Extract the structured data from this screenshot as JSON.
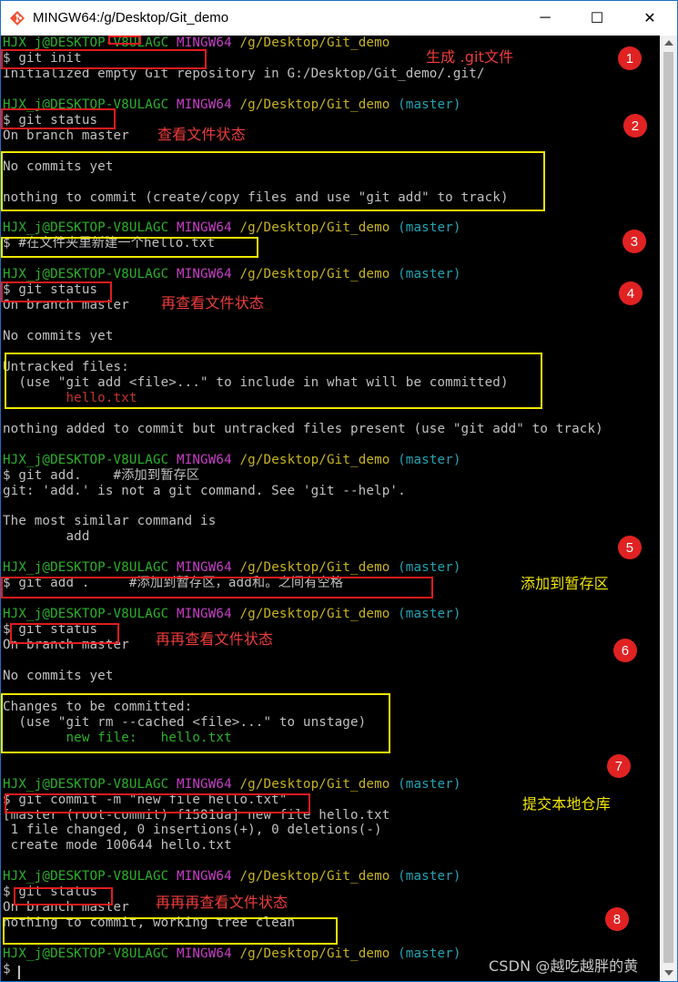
{
  "window": {
    "title": "MINGW64:/g/Desktop/Git_demo",
    "minimize_glyph": "─",
    "maximize_glyph": "☐",
    "close_glyph": "✕"
  },
  "prompt": {
    "user": "HJX_j@DESKTOP-V8ULAGC",
    "shell": "MINGW64",
    "path": "/g/Desktop/Git_demo",
    "branch": "(master)"
  },
  "lines": [
    {
      "segments": [
        {
          "t": "HJX_j@DESKTOP-V8ULAGC",
          "c": "g"
        },
        {
          "t": " "
        },
        {
          "t": "MINGW64",
          "c": "m"
        },
        {
          "t": " "
        },
        {
          "t": "/g/Desktop/Git_demo",
          "c": "y"
        }
      ]
    },
    {
      "segments": [
        {
          "t": "$ git init"
        }
      ]
    },
    {
      "segments": [
        {
          "t": "Initialized empty Git repository in G:/Desktop/Git_demo/.git/"
        }
      ]
    },
    {
      "segments": []
    },
    {
      "segments": [
        {
          "t": "HJX_j@DESKTOP-V8ULAGC",
          "c": "g"
        },
        {
          "t": " "
        },
        {
          "t": "MINGW64",
          "c": "m"
        },
        {
          "t": " "
        },
        {
          "t": "/g/Desktop/Git_demo",
          "c": "y"
        },
        {
          "t": " "
        },
        {
          "t": "(master)",
          "c": "c"
        }
      ]
    },
    {
      "segments": [
        {
          "t": "$ git status"
        }
      ]
    },
    {
      "segments": [
        {
          "t": "On branch master"
        }
      ]
    },
    {
      "segments": []
    },
    {
      "segments": [
        {
          "t": "No commits yet"
        }
      ]
    },
    {
      "segments": []
    },
    {
      "segments": [
        {
          "t": "nothing to commit (create/copy files and use \"git add\" to track)"
        }
      ]
    },
    {
      "segments": []
    },
    {
      "segments": [
        {
          "t": "HJX_j@DESKTOP-V8ULAGC",
          "c": "g"
        },
        {
          "t": " "
        },
        {
          "t": "MINGW64",
          "c": "m"
        },
        {
          "t": " "
        },
        {
          "t": "/g/Desktop/Git_demo",
          "c": "y"
        },
        {
          "t": " "
        },
        {
          "t": "(master)",
          "c": "c"
        }
      ]
    },
    {
      "segments": [
        {
          "t": "$ #在文件夹里新建一个hello.txt"
        }
      ]
    },
    {
      "segments": []
    },
    {
      "segments": [
        {
          "t": "HJX_j@DESKTOP-V8ULAGC",
          "c": "g"
        },
        {
          "t": " "
        },
        {
          "t": "MINGW64",
          "c": "m"
        },
        {
          "t": " "
        },
        {
          "t": "/g/Desktop/Git_demo",
          "c": "y"
        },
        {
          "t": " "
        },
        {
          "t": "(master)",
          "c": "c"
        }
      ]
    },
    {
      "segments": [
        {
          "t": "$ git status"
        }
      ]
    },
    {
      "segments": [
        {
          "t": "On branch master"
        }
      ]
    },
    {
      "segments": []
    },
    {
      "segments": [
        {
          "t": "No commits yet"
        }
      ]
    },
    {
      "segments": []
    },
    {
      "segments": [
        {
          "t": "Untracked files:"
        }
      ]
    },
    {
      "segments": [
        {
          "t": "  (use \"git add <file>...\" to include in what will be committed)"
        }
      ]
    },
    {
      "segments": [
        {
          "t": "        "
        },
        {
          "t": "hello.txt",
          "c": "r"
        }
      ]
    },
    {
      "segments": []
    },
    {
      "segments": [
        {
          "t": "nothing added to commit but untracked files present (use \"git add\" to track)"
        }
      ]
    },
    {
      "segments": []
    },
    {
      "segments": [
        {
          "t": "HJX_j@DESKTOP-V8ULAGC",
          "c": "g"
        },
        {
          "t": " "
        },
        {
          "t": "MINGW64",
          "c": "m"
        },
        {
          "t": " "
        },
        {
          "t": "/g/Desktop/Git_demo",
          "c": "y"
        },
        {
          "t": " "
        },
        {
          "t": "(master)",
          "c": "c"
        }
      ]
    },
    {
      "segments": [
        {
          "t": "$ git add.    #添加到暂存区"
        }
      ]
    },
    {
      "segments": [
        {
          "t": "git: 'add.' is not a git command. See 'git --help'."
        }
      ]
    },
    {
      "segments": []
    },
    {
      "segments": [
        {
          "t": "The most similar command is"
        }
      ]
    },
    {
      "segments": [
        {
          "t": "        add"
        }
      ]
    },
    {
      "segments": []
    },
    {
      "segments": [
        {
          "t": "HJX_j@DESKTOP-V8ULAGC",
          "c": "g"
        },
        {
          "t": " "
        },
        {
          "t": "MINGW64",
          "c": "m"
        },
        {
          "t": " "
        },
        {
          "t": "/g/Desktop/Git_demo",
          "c": "y"
        },
        {
          "t": " "
        },
        {
          "t": "(master)",
          "c": "c"
        }
      ]
    },
    {
      "segments": [
        {
          "t": "$ git add .     #添加到暂存区，add和。之间有空格"
        }
      ]
    },
    {
      "segments": []
    },
    {
      "segments": [
        {
          "t": "HJX_j@DESKTOP-V8ULAGC",
          "c": "g"
        },
        {
          "t": " "
        },
        {
          "t": "MINGW64",
          "c": "m"
        },
        {
          "t": " "
        },
        {
          "t": "/g/Desktop/Git_demo",
          "c": "y"
        },
        {
          "t": " "
        },
        {
          "t": "(master)",
          "c": "c"
        }
      ]
    },
    {
      "segments": [
        {
          "t": "$ git status"
        }
      ]
    },
    {
      "segments": [
        {
          "t": "On branch master"
        }
      ]
    },
    {
      "segments": []
    },
    {
      "segments": [
        {
          "t": "No commits yet"
        }
      ]
    },
    {
      "segments": []
    },
    {
      "segments": [
        {
          "t": "Changes to be committed:"
        }
      ]
    },
    {
      "segments": [
        {
          "t": "  (use \"git rm --cached <file>...\" to unstage)"
        }
      ]
    },
    {
      "segments": [
        {
          "t": "        "
        },
        {
          "t": "new file:   hello.txt",
          "c": "g"
        }
      ]
    },
    {
      "segments": []
    },
    {
      "segments": []
    },
    {
      "segments": [
        {
          "t": "HJX_j@DESKTOP-V8ULAGC",
          "c": "g"
        },
        {
          "t": " "
        },
        {
          "t": "MINGW64",
          "c": "m"
        },
        {
          "t": " "
        },
        {
          "t": "/g/Desktop/Git_demo",
          "c": "y"
        },
        {
          "t": " "
        },
        {
          "t": "(master)",
          "c": "c"
        }
      ]
    },
    {
      "segments": [
        {
          "t": "$ git commit -m \"new file hello.txt\""
        }
      ]
    },
    {
      "segments": [
        {
          "t": "[master (root-commit) f1581da] new file hello.txt"
        }
      ]
    },
    {
      "segments": [
        {
          "t": " 1 file changed, 0 insertions(+), 0 deletions(-)"
        }
      ]
    },
    {
      "segments": [
        {
          "t": " create mode 100644 hello.txt"
        }
      ]
    },
    {
      "segments": []
    },
    {
      "segments": [
        {
          "t": "HJX_j@DESKTOP-V8ULAGC",
          "c": "g"
        },
        {
          "t": " "
        },
        {
          "t": "MINGW64",
          "c": "m"
        },
        {
          "t": " "
        },
        {
          "t": "/g/Desktop/Git_demo",
          "c": "y"
        },
        {
          "t": " "
        },
        {
          "t": "(master)",
          "c": "c"
        }
      ]
    },
    {
      "segments": [
        {
          "t": "$ git status"
        }
      ]
    },
    {
      "segments": [
        {
          "t": "On branch master"
        }
      ]
    },
    {
      "segments": [
        {
          "t": "nothing to commit, working tree clean"
        }
      ]
    },
    {
      "segments": []
    },
    {
      "segments": [
        {
          "t": "HJX_j@DESKTOP-V8ULAGC",
          "c": "g"
        },
        {
          "t": " "
        },
        {
          "t": "MINGW64",
          "c": "m"
        },
        {
          "t": " "
        },
        {
          "t": "/g/Desktop/Git_demo",
          "c": "y"
        },
        {
          "t": " "
        },
        {
          "t": "(master)",
          "c": "c"
        }
      ]
    },
    {
      "segments": [
        {
          "t": "$ "
        }
      ]
    }
  ],
  "annotations": {
    "notes": [
      {
        "text": "生成 .git文件",
        "color": "red"
      },
      {
        "text": "查看文件状态",
        "color": "red"
      },
      {
        "text": "再查看文件状态",
        "color": "red"
      },
      {
        "text": "添加到暂存区",
        "color": "yellow"
      },
      {
        "text": "再再查看文件状态",
        "color": "red"
      },
      {
        "text": "提交本地仓库",
        "color": "yellow"
      },
      {
        "text": "再再再查看文件状态",
        "color": "red"
      }
    ],
    "steps": [
      "1",
      "2",
      "3",
      "4",
      "5",
      "6",
      "7",
      "8"
    ]
  },
  "watermark": "CSDN @越吃越胖的黄",
  "colors": {
    "terminal_bg": "#000000",
    "text": "#c0c0c0",
    "prompt_user": "#2ab12a",
    "prompt_shell": "#c83ec8",
    "prompt_path": "#c8b420",
    "prompt_branch": "#22a4b4",
    "untracked": "#c83232",
    "annotation_red": "#e11c1c",
    "annotation_yellow": "#f0e600"
  }
}
